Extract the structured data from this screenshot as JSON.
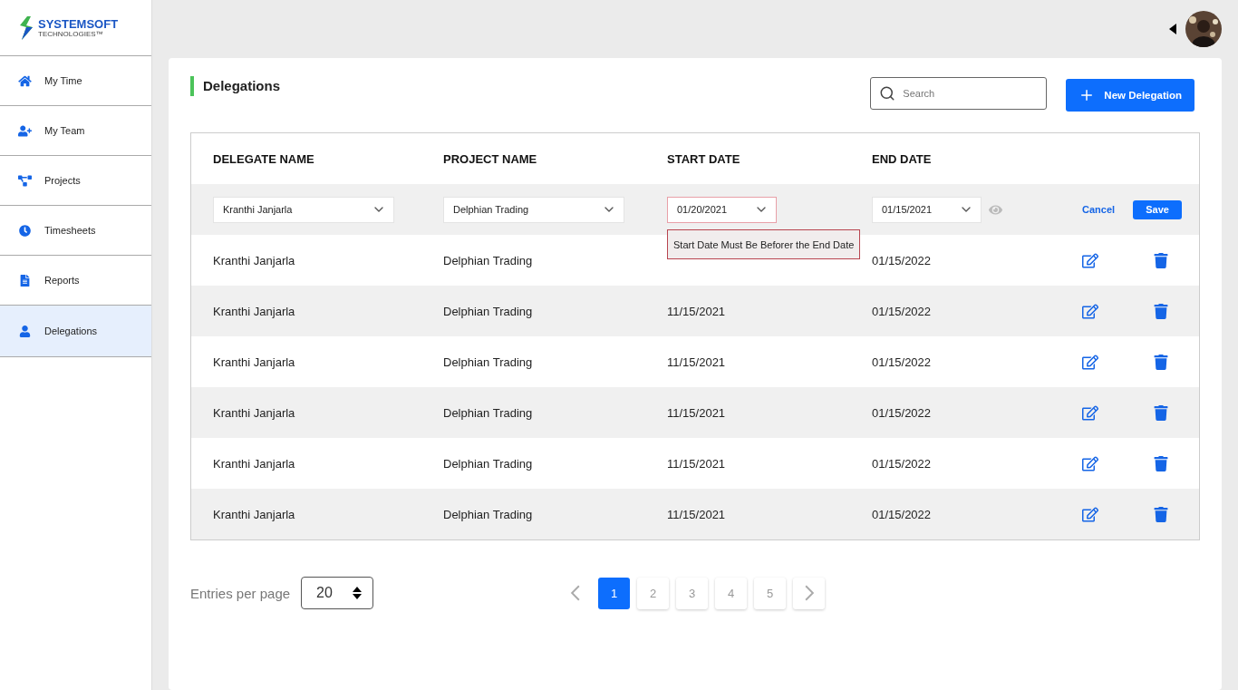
{
  "logo": {
    "name": "SYSTEMSOFT",
    "sub": "TECHNOLOGIES™"
  },
  "sidebar": {
    "items": [
      {
        "label": "My Time",
        "selected": false
      },
      {
        "label": "My Team",
        "selected": false
      },
      {
        "label": "Projects",
        "selected": false
      },
      {
        "label": "Timesheets",
        "selected": false
      },
      {
        "label": "Reports",
        "selected": false
      },
      {
        "label": "Delegations",
        "selected": true
      }
    ]
  },
  "page": {
    "title": "Delegations",
    "search": {
      "placeholder": "Search"
    },
    "new_button": "New Delegation"
  },
  "table": {
    "columns": [
      "DELEGATE NAME",
      "PROJECT NAME",
      "START DATE",
      "END DATE"
    ],
    "edit_row": {
      "delegate": "Kranthi Janjarla",
      "project": "Delphian Trading",
      "start_date": "01/20/2021",
      "start_invalid": true,
      "end_date": "01/15/2021",
      "cancel": "Cancel",
      "save": "Save",
      "error": "Start Date Must Be Beforer the End Date"
    },
    "rows": [
      {
        "delegate": "Kranthi Janjarla",
        "project": "Delphian Trading",
        "end_date": "01/15/2022"
      },
      {
        "delegate": "Kranthi Janjarla",
        "project": "Delphian Trading",
        "start_date": "11/15/2021",
        "end_date": "01/15/2022"
      },
      {
        "delegate": "Kranthi Janjarla",
        "project": "Delphian Trading",
        "start_date": "11/15/2021",
        "end_date": "01/15/2022"
      },
      {
        "delegate": "Kranthi Janjarla",
        "project": "Delphian Trading",
        "start_date": "11/15/2021",
        "end_date": "01/15/2022"
      },
      {
        "delegate": "Kranthi Janjarla",
        "project": "Delphian Trading",
        "start_date": "11/15/2021",
        "end_date": "01/15/2022"
      },
      {
        "delegate": "Kranthi Janjarla",
        "project": "Delphian Trading",
        "start_date": "11/15/2021",
        "end_date": "01/15/2022"
      }
    ]
  },
  "footer": {
    "entries_label": "Entries per page",
    "entries_value": "20",
    "pages": [
      {
        "label": "1",
        "selected": true
      },
      {
        "label": "2",
        "selected": false
      },
      {
        "label": "3",
        "selected": false
      },
      {
        "label": "4",
        "selected": false
      },
      {
        "label": "5",
        "selected": false
      }
    ]
  }
}
